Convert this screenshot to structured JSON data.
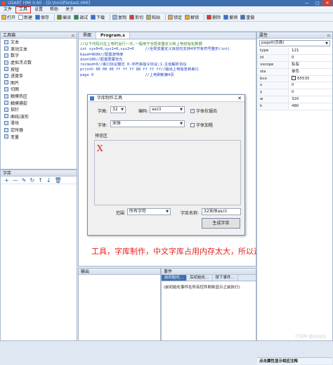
{
  "window": {
    "title": "USART HMI 0.60 - [D:\\hmi\\file\\test.HMI]",
    "controls": [
      "—",
      "□",
      "✕"
    ]
  },
  "menu": [
    "文件",
    "工具",
    "设置",
    "帮助",
    "关于"
  ],
  "toolbar": [
    {
      "icon": "open-icon",
      "label": "打开",
      "color": "#e7b13c"
    },
    {
      "icon": "new-icon",
      "label": "新建",
      "color": "#ffffff"
    },
    {
      "icon": "save-icon",
      "label": "保存",
      "color": "#3c6fc8"
    },
    {
      "icon": "sep"
    },
    {
      "icon": "compile-icon",
      "label": "编译",
      "color": "#6a8a3a"
    },
    {
      "icon": "debug-icon",
      "label": "调试",
      "color": "#2f8a3a"
    },
    {
      "icon": "download-icon",
      "label": "下载",
      "color": "#3c6fc8"
    },
    {
      "icon": "sep"
    },
    {
      "icon": "copy-icon",
      "label": "复制",
      "color": "#9ab3d6"
    },
    {
      "icon": "cut-icon",
      "label": "剪切",
      "color": "#c04a3a"
    },
    {
      "icon": "paste-icon",
      "label": "粘贴",
      "color": "#c9a64a"
    },
    {
      "icon": "sep"
    },
    {
      "icon": "lock-icon",
      "label": "锁定",
      "color": "#e0a83c"
    },
    {
      "icon": "unlock-icon",
      "label": "解锁",
      "color": "#e0a83c"
    },
    {
      "icon": "sep"
    },
    {
      "icon": "delete-icon",
      "label": "删除",
      "color": "#d23a2a"
    },
    {
      "icon": "undo-icon",
      "label": "撤销",
      "color": "#3c6fc8"
    },
    {
      "icon": "redo-icon",
      "label": "重做",
      "color": "#3c6fc8"
    }
  ],
  "toolbox": {
    "title": "工具箱",
    "items": [
      "文本",
      "滚动文本",
      "数字",
      "虚拟浮点数",
      "按钮",
      "进度条",
      "图片",
      "切图",
      "触摸热区",
      "触摸捕捉",
      "指针",
      "曲线/波形",
      "滑块",
      "定时器",
      "变量"
    ]
  },
  "fontlib": {
    "title": "字库",
    "icons": [
      "+",
      "—",
      "✎",
      "↻",
      "↑",
      "↓",
      "🗑"
    ]
  },
  "tabs": [
    "界面",
    "Program.s"
  ],
  "code": [
    {
      "t": "//以下代码只在上电时运行一次,一般用于全局变量定义和上电初始化数据",
      "c": "green"
    },
    {
      "t": "int sys0=0,sys1=0,sys2=0     //全局变量定义目前仅支持4字节有符号整形(int)",
      "c": "blue"
    },
    {
      "t": "baud=9600//配置波特率",
      "c": "blue"
    },
    {
      "t": "dim=100//配置屏幕背光",
      "c": "blue"
    },
    {
      "t": "recmod=0//串口协议模式 0-字符串指令协议;1-主动解析协议",
      "c": "blue"
    },
    {
      "t": "printh 00 00 00 ff ff ff 88 ff ff ff//输出上电信息到串口",
      "c": "blue"
    },
    {
      "t": "page 0                       //上电刷新第0页",
      "c": "blue"
    }
  ],
  "dialog": {
    "title": "字库制作工具",
    "height_label": "字高:",
    "height_value": "32",
    "encoding_label": "编码:",
    "encoding_value": "ascii",
    "antialias_label": "字体抗锯齿",
    "antialias_checked": "✓",
    "font_label": "字体:",
    "font_value": "宋体",
    "bold_label": "字体加粗",
    "bold_checked": "",
    "preview_label": "预览区",
    "preview_char": "X",
    "range_label": "范围",
    "range_value": "所有字符",
    "libname_label": "字库名称:",
    "libname_value": "32宋体ascii",
    "generate_button": "生成字库"
  },
  "annotation": "工具，字库制作，中文字库占用内存太大，所以选择ascii码",
  "output": {
    "title": "输出"
  },
  "events": {
    "title": "事件",
    "tabs": [
      "前初始化...",
      "后初始化...",
      "按下事件...",
      "弹起事件..."
    ],
    "text": "(前初始化事件在所有控件刷新显示之前执行)"
  },
  "props": {
    "title": "属性",
    "selector": "page0(页面)",
    "rows": [
      {
        "k": "type",
        "v": "121"
      },
      {
        "k": "id",
        "v": "0"
      },
      {
        "k": "vscope",
        "v": "私有"
      },
      {
        "k": "sta",
        "v": "单色"
      },
      {
        "k": "bco",
        "v": "65535",
        "swatch": "#ffffff"
      },
      {
        "k": "x",
        "v": "0"
      },
      {
        "k": "y",
        "v": "0"
      },
      {
        "k": "w",
        "v": "320"
      },
      {
        "k": "h",
        "v": "480"
      }
    ],
    "footer": "点击属性显示相应注释"
  },
  "watermark": "CSDN @pzspzj"
}
